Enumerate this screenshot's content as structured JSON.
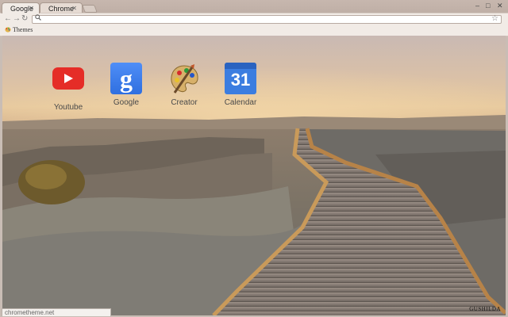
{
  "tabs": [
    {
      "label": "Google",
      "close_icon": "close-icon"
    },
    {
      "label": "Chrome",
      "close_icon": "close-icon"
    }
  ],
  "window_controls": {
    "minimize": "–",
    "maximize": "□",
    "close": "✕"
  },
  "toolbar": {
    "back": "←",
    "forward": "→",
    "reload": "↻",
    "search_icon": "search-icon",
    "url": "",
    "star_icon": "star-icon"
  },
  "bookmarks": {
    "items": [
      {
        "label": "Themes",
        "icon": "themes-icon"
      }
    ]
  },
  "apps": [
    {
      "label": "Youtube",
      "icon": "youtube-icon",
      "color": "#e52d27"
    },
    {
      "label": "Google",
      "icon": "google-icon",
      "color": "#3b7de0"
    },
    {
      "label": "Creator",
      "icon": "palette-icon",
      "color": "#d9a441"
    },
    {
      "label": "Calendar",
      "icon": "calendar-icon",
      "color": "#3b7de0",
      "day": "31"
    }
  ],
  "google_glyph": "g",
  "watermark": "GUSHILDA",
  "status_text": "chrometheme.net"
}
